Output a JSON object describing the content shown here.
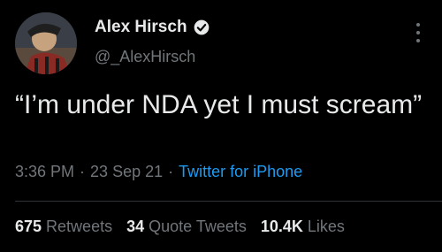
{
  "tweet": {
    "author": {
      "display_name": "Alex Hirsch",
      "handle": "@_AlexHirsch",
      "verified": true
    },
    "text": "“I’m under NDA yet I must scream”",
    "time": "3:36 PM",
    "date": "23 Sep 21",
    "source": "Twitter for iPhone",
    "separator": "·"
  },
  "stats": {
    "retweets": {
      "value": "675",
      "label": "Retweets"
    },
    "quote_tweets": {
      "value": "34",
      "label": "Quote Tweets"
    },
    "likes": {
      "value": "10.4K",
      "label": "Likes"
    }
  },
  "colors": {
    "background": "#000000",
    "text": "#e7e9ea",
    "muted": "#71767b",
    "link": "#1d9bf0",
    "divider": "#2f3336"
  },
  "icons": {
    "verified": "verified-badge-icon",
    "more": "more-options-icon"
  }
}
